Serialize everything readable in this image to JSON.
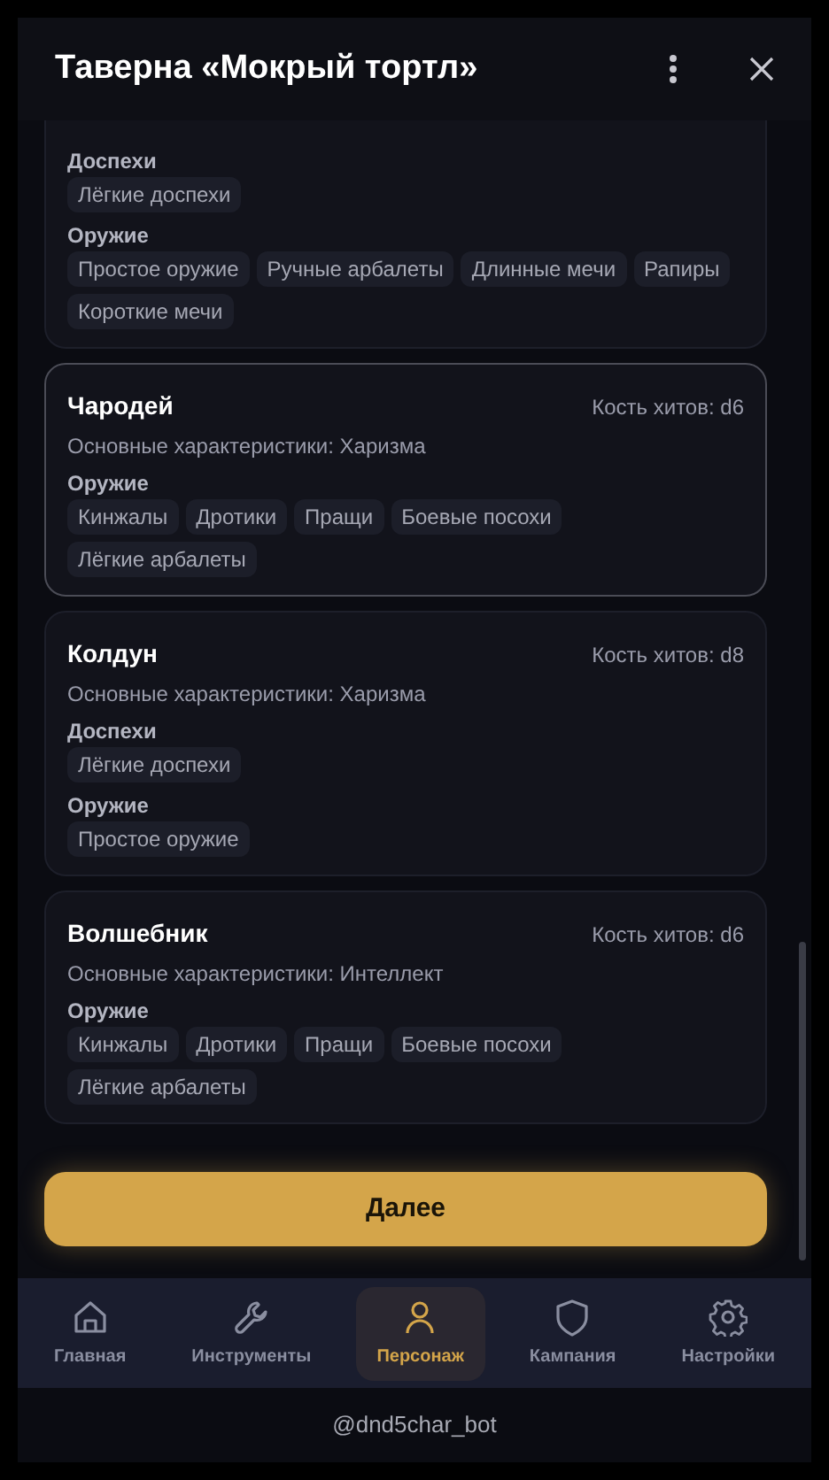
{
  "window": {
    "title": "Таверна «Мокрый тортл»"
  },
  "classes": [
    {
      "selected": false,
      "sections": [
        {
          "label": "Доспехи",
          "tags": [
            "Лёгкие доспехи"
          ]
        },
        {
          "label": "Оружие",
          "tags": [
            "Простое оружие",
            "Ручные арбалеты",
            "Длинные мечи",
            "Рапиры",
            "Короткие мечи"
          ]
        }
      ]
    },
    {
      "name": "Чародей",
      "hit_die": "Кость хитов: d6",
      "abilities": "Основные характеристики: Харизма",
      "selected": true,
      "sections": [
        {
          "label": "Оружие",
          "tags": [
            "Кинжалы",
            "Дротики",
            "Пращи",
            "Боевые посохи",
            "Лёгкие арбалеты"
          ]
        }
      ]
    },
    {
      "name": "Колдун",
      "hit_die": "Кость хитов: d8",
      "abilities": "Основные характеристики: Харизма",
      "selected": false,
      "sections": [
        {
          "label": "Доспехи",
          "tags": [
            "Лёгкие доспехи"
          ]
        },
        {
          "label": "Оружие",
          "tags": [
            "Простое оружие"
          ]
        }
      ]
    },
    {
      "name": "Волшебник",
      "hit_die": "Кость хитов: d6",
      "abilities": "Основные характеристики: Интеллект",
      "selected": false,
      "sections": [
        {
          "label": "Оружие",
          "tags": [
            "Кинжалы",
            "Дротики",
            "Пращи",
            "Боевые посохи",
            "Лёгкие арбалеты"
          ]
        }
      ]
    }
  ],
  "next_button": "Далее",
  "nav": [
    {
      "label": "Главная",
      "selected": false
    },
    {
      "label": "Инструменты",
      "selected": false
    },
    {
      "label": "Персонаж",
      "selected": true
    },
    {
      "label": "Кампания",
      "selected": false
    },
    {
      "label": "Настройки",
      "selected": false
    }
  ],
  "footer": "@dnd5char_bot"
}
